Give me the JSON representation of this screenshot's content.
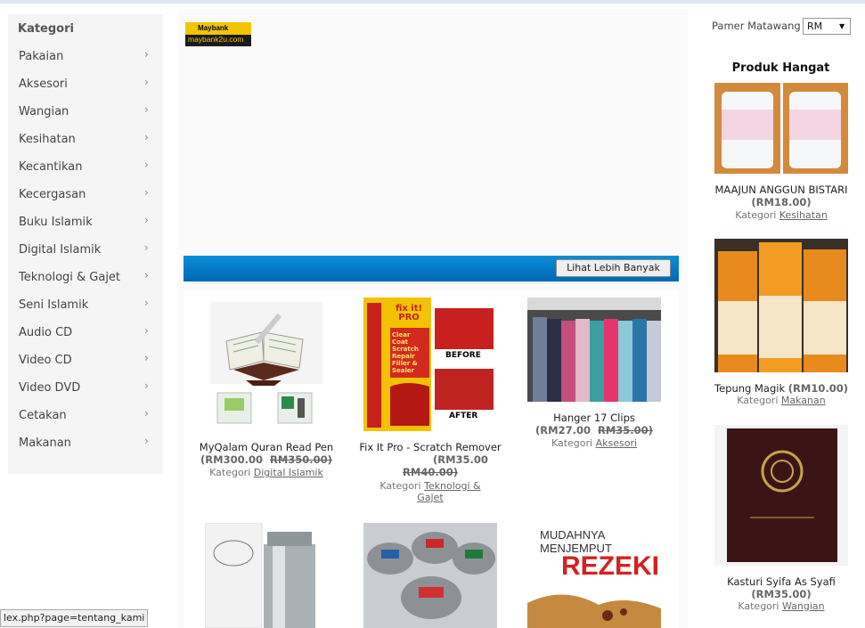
{
  "sidebar": {
    "title": "Kategori",
    "items": [
      "Pakaian",
      "Aksesori",
      "Wangian",
      "Kesihatan",
      "Kecantikan",
      "Kecergasan",
      "Buku Islamik",
      "Digital Islamik",
      "Teknologi & Gajet",
      "Seni Islamik",
      "Audio CD",
      "Video CD",
      "Video DVD",
      "Cetakan",
      "Makanan"
    ],
    "chevron": "›"
  },
  "logo": {
    "brand": "Maybank",
    "sub": "maybank2u.com"
  },
  "products_bar": {
    "more_label": "Lihat Lebih Banyak"
  },
  "products": [
    {
      "name": "MyQalam Quran Read Pen",
      "price": "(RM300.00",
      "old_price": "RM350.00)",
      "category_label": "Kategori",
      "category": "Digital Islamik"
    },
    {
      "name": "Fix It Pro - Scratch Remover",
      "price": "(RM35.00",
      "old_price": "RM40.00)",
      "category_label": "Kategori",
      "category": "Teknologi & Gajet"
    },
    {
      "name": "Hanger 17 Clips",
      "price": "(RM27.00",
      "old_price": "RM35.00)",
      "category_label": "Kategori",
      "category": "Aksesori"
    }
  ],
  "product_images": {
    "fixit_brand": "fix it! PRO",
    "fixit_tag": "Clear Coat Scratch Repair Filler & Sealer",
    "before": "BEFORE",
    "after": "AFTER",
    "book_top": "MUDAHNYA MENJEMPUT",
    "book_big": "REZEKI"
  },
  "currency": {
    "label": "Pamer Matawang",
    "value": "RM"
  },
  "hot": {
    "title": "Produk Hangat",
    "items": [
      {
        "name": "MAAJUN ANGGUN BISTARI",
        "price": "(RM18.00)",
        "category_label": "Kategori",
        "category": "Kesihatan"
      },
      {
        "name": "Tepung Magik",
        "price": "(RM10.00)",
        "category_label": "Kategori",
        "category": "Makanan"
      },
      {
        "name": "Kasturi Syifa As Syafi",
        "price": "(RM35.00)",
        "category_label": "Kategori",
        "category": "Wangian"
      }
    ]
  },
  "status_url": "lex.php?page=tentang_kami",
  "colors": {
    "accent_blue": "#0a7fd0",
    "sidebar_bg": "#f5f5f5"
  }
}
